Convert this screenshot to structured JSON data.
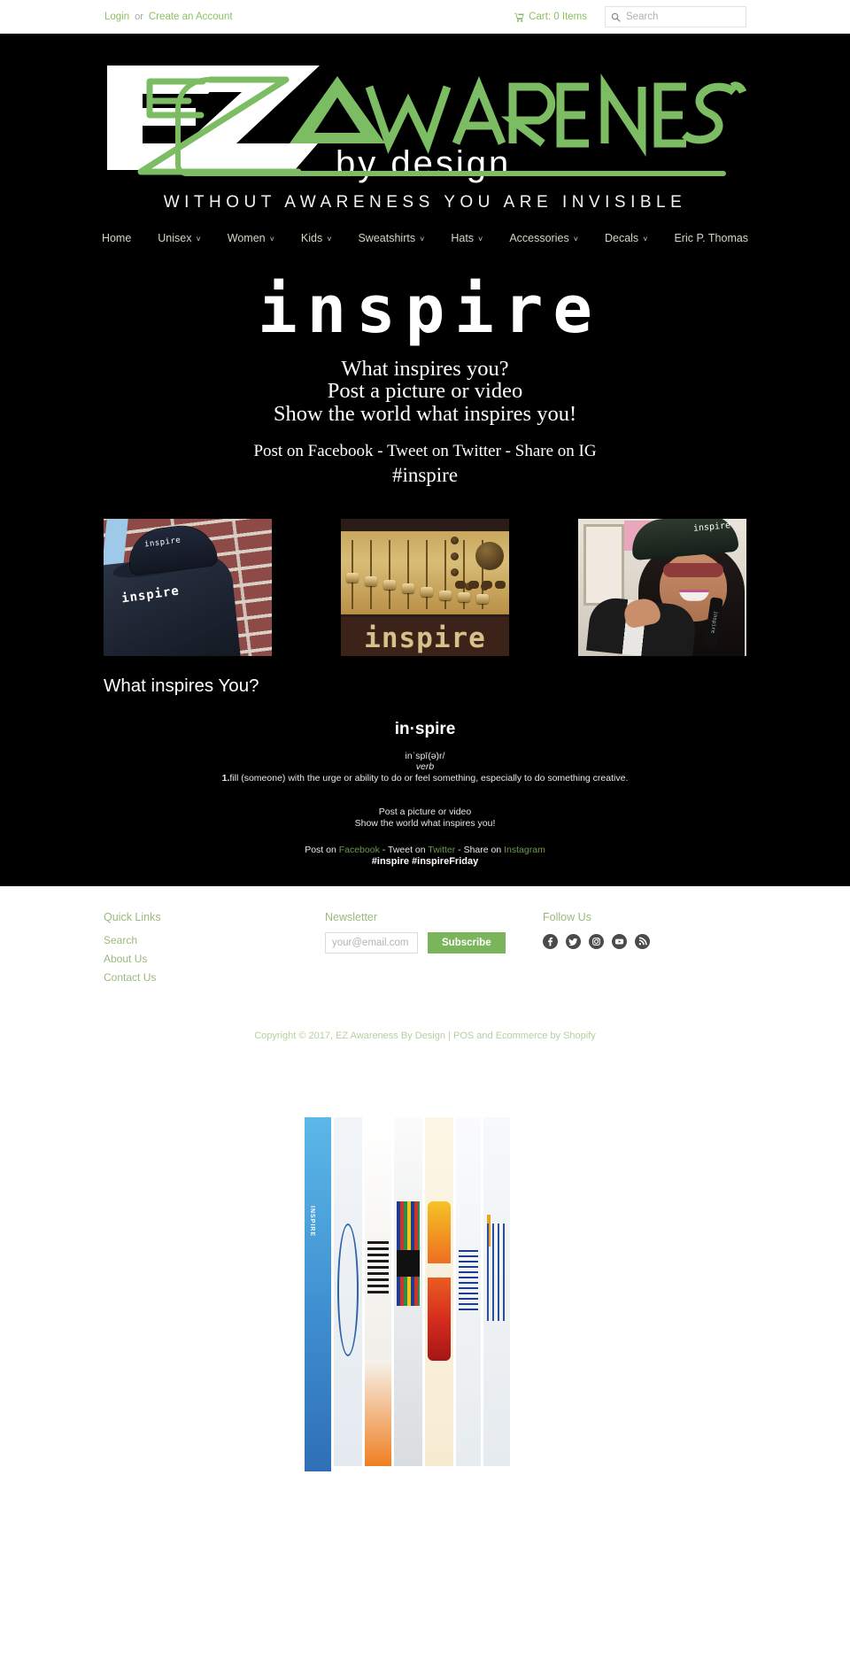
{
  "topbar": {
    "login_label": "Login",
    "or_label": "or",
    "create_account_label": "Create an Account",
    "cart_label": "Cart: 0 Items",
    "cart_icon": "shopping-cart-icon",
    "search_icon": "search-icon",
    "search_placeholder": "Search",
    "search_value": ""
  },
  "brand": {
    "logo_ez": "EZ",
    "logo_awareness": "AWARENESS",
    "logo_by_design": "by design",
    "tagline": "WITHOUT AWARENESS YOU ARE INVISIBLE",
    "green": "#7cbc63",
    "white": "#ffffff"
  },
  "nav": {
    "items": [
      {
        "label": "Home",
        "caret": ""
      },
      {
        "label": "Unisex",
        "caret": "˅"
      },
      {
        "label": "Women",
        "caret": "˅"
      },
      {
        "label": "Kids",
        "caret": "˅"
      },
      {
        "label": "Sweatshirts",
        "caret": "˅"
      },
      {
        "label": "Hats",
        "caret": "˅"
      },
      {
        "label": "Accessories",
        "caret": "˅"
      },
      {
        "label": "Decals",
        "caret": "˅"
      },
      {
        "label": "Eric P. Thomas",
        "caret": ""
      }
    ]
  },
  "hero": {
    "word": "inspire",
    "line1": "What inspires you?",
    "line2": "Post a picture or video",
    "line3": "Show the world what inspires you!",
    "social_line": "Post on Facebook - Tweet on Twitter - Share on IG",
    "hashtag": "#inspire"
  },
  "photos": [
    {
      "name": "inspire-shirt-and-cap-brick-wall",
      "cap_text": "inspire",
      "shirt_text": "inspire"
    },
    {
      "name": "inspire-mixing-console",
      "word": "inspire"
    },
    {
      "name": "woman-wearing-inspire-cap",
      "cap_text": "inspire",
      "band_text": "inspire"
    }
  ],
  "main": {
    "section_title": "What inspires You?",
    "definition": {
      "word": "in·spire",
      "phonetic": "inˈspī(ə)r/",
      "part_of_speech": "verb",
      "sense_number": "1.",
      "sense_text": "fill (someone) with the urge or ability to do or feel something, especially to do something creative."
    },
    "cta_line1": "Post a picture or video",
    "cta_line2": "Show the world what inspires you!",
    "social": {
      "prefix1": "Post on ",
      "facebook": "Facebook",
      "mid1": " - Tweet on ",
      "twitter": "Twitter",
      "mid2": " - Share on ",
      "instagram": "Instagram"
    },
    "hashtags": "#inspire #inspireFriday"
  },
  "footer": {
    "quick_links": {
      "title": "Quick Links",
      "items": [
        {
          "label": "Search"
        },
        {
          "label": "About Us"
        },
        {
          "label": "Contact Us"
        }
      ]
    },
    "newsletter": {
      "title": "Newsletter",
      "email_placeholder": "your@email.com",
      "email_value": "",
      "subscribe_label": "Subscribe"
    },
    "follow": {
      "title": "Follow Us",
      "icons": [
        "facebook-icon",
        "twitter-icon",
        "instagram-icon",
        "youtube-icon",
        "rss-icon"
      ]
    },
    "copyright_prefix": "Copyright © 2017, ",
    "copyright_store": "EZ Awareness By Design",
    "copyright_mid": " | ",
    "copyright_pos": "POS",
    "copyright_and": " and ",
    "copyright_ecommerce": "Ecommerce by Shopify"
  },
  "bottom_image": {
    "name": "book-spines-photo",
    "spine_text": "INSPIRE"
  },
  "colors": {
    "accent_green": "#7ab55c",
    "link_green": "#8cc161",
    "footer_green": "#9db87e",
    "black": "#000000"
  }
}
